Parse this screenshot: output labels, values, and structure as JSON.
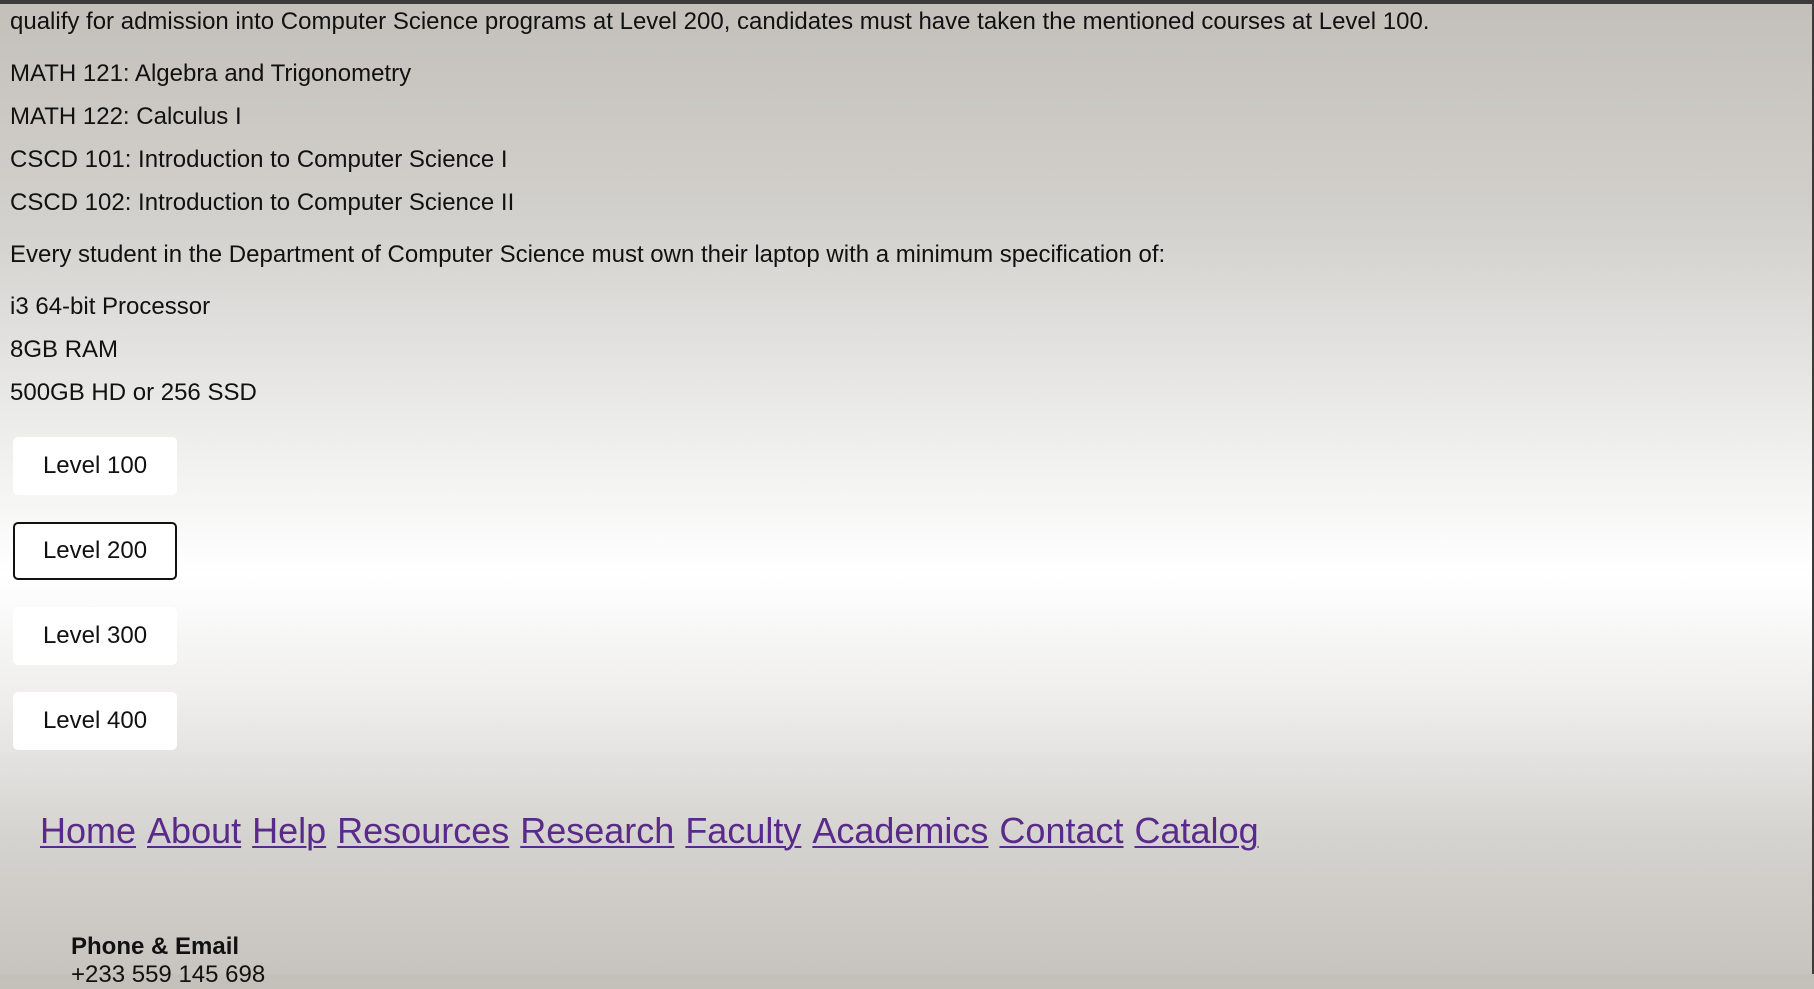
{
  "intro": {
    "text": "qualify for admission into Computer Science programs at Level 200, candidates must have taken the mentioned courses at Level 100."
  },
  "courses": [
    "MATH 121: Algebra and Trigonometry",
    "MATH 122: Calculus I",
    "CSCD 101: Introduction to Computer Science I",
    "CSCD 102: Introduction to Computer Science II"
  ],
  "laptop": {
    "text": "Every student in the Department of Computer Science must own their laptop with a minimum specification of:",
    "specs": [
      "i3 64-bit Processor",
      "8GB RAM",
      "500GB HD or 256 SSD"
    ]
  },
  "levels": [
    {
      "label": "Level 100",
      "active": false
    },
    {
      "label": "Level 200",
      "active": true
    },
    {
      "label": "Level 300",
      "active": false
    },
    {
      "label": "Level 400",
      "active": false
    }
  ],
  "nav": [
    "Home",
    "About",
    "Help",
    "Resources",
    "Research",
    "Faculty",
    "Academics",
    "Contact",
    "Catalog"
  ],
  "footer": {
    "heading": "Phone & Email",
    "phone": "+233 559 145 698"
  },
  "colors": {
    "link": "#5a2a8a",
    "top_border": "#3b3b3b"
  }
}
